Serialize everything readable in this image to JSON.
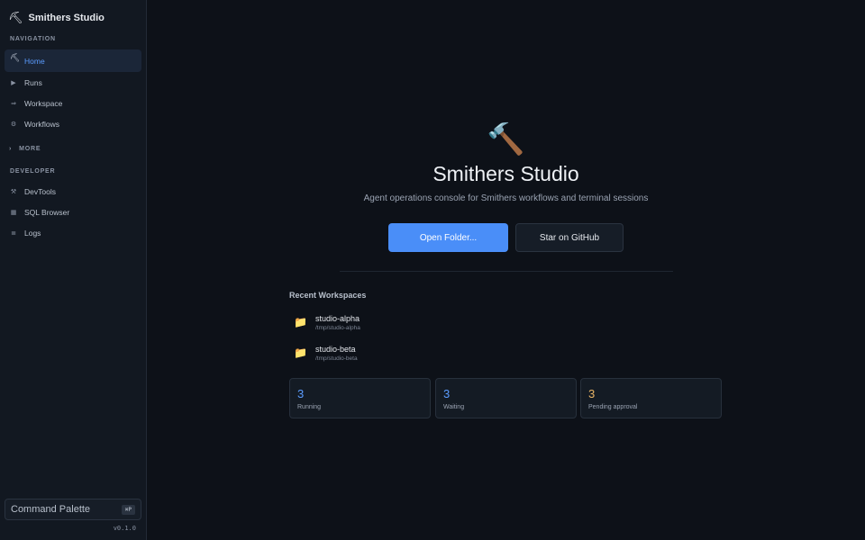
{
  "app": {
    "title": "Smithers Studio",
    "logo_icon": "⛏"
  },
  "sidebar": {
    "nav_heading": "NAVIGATION",
    "nav_items": [
      {
        "label": "Home",
        "icon": "pick-icon",
        "glyph": "⛏",
        "active": true
      },
      {
        "label": "Runs",
        "icon": "play-icon",
        "glyph": "▶"
      },
      {
        "label": "Workspace",
        "icon": "arrow-icon",
        "glyph": "⇒"
      },
      {
        "label": "Workflows",
        "icon": "gear-icon",
        "glyph": "⚙"
      }
    ],
    "more_label": "MORE",
    "dev_heading": "DEVELOPER",
    "dev_items": [
      {
        "label": "DevTools",
        "icon": "tools-icon",
        "glyph": "⚒"
      },
      {
        "label": "SQL Browser",
        "icon": "grid-icon",
        "glyph": "▦"
      },
      {
        "label": "Logs",
        "icon": "list-icon",
        "glyph": "≣"
      }
    ],
    "command_palette": {
      "label": "Command Palette",
      "shortcut": "⌘P"
    },
    "version": "v0.1.0"
  },
  "hero": {
    "icon": "🔨",
    "title": "Smithers Studio",
    "subtitle": "Agent operations console for Smithers workflows and terminal sessions",
    "primary_button": "Open Folder...",
    "secondary_button": "Star on GitHub"
  },
  "recent": {
    "title": "Recent Workspaces",
    "items": [
      {
        "name": "studio-alpha",
        "path": "/tmp/studio-alpha",
        "icon": "folder-icon"
      },
      {
        "name": "studio-beta",
        "path": "/tmp/studio-beta",
        "icon": "folder-icon"
      }
    ]
  },
  "stats": [
    {
      "value": "3",
      "label": "Running",
      "color": "#5b9cff"
    },
    {
      "value": "3",
      "label": "Waiting",
      "color": "#5b9cff"
    },
    {
      "value": "3",
      "label": "Pending approval",
      "color": "#e8b466"
    }
  ],
  "colors": {
    "accent": "#4a8ef8",
    "background": "#0d1118",
    "sidebar": "#121821"
  }
}
